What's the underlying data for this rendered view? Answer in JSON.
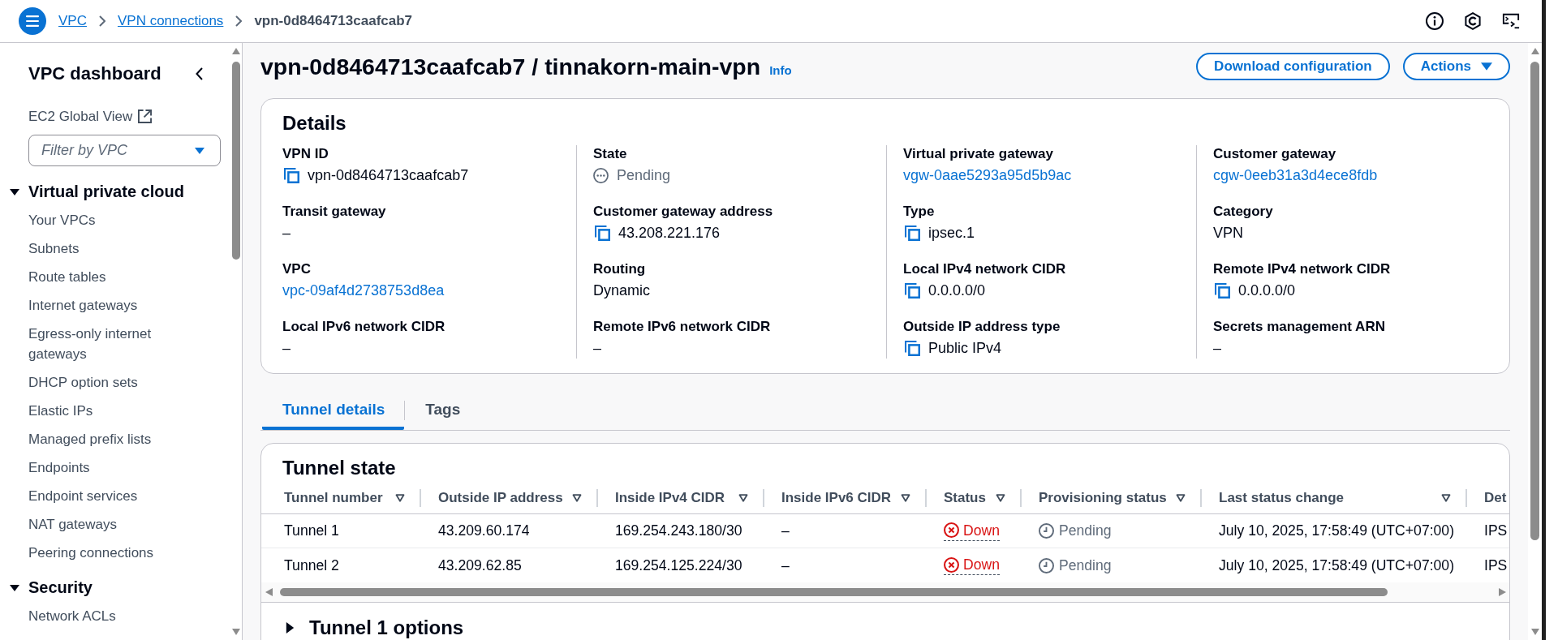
{
  "top_bar": {
    "breadcrumbs": [
      {
        "label": "VPC",
        "kind": "link"
      },
      {
        "label": "VPN connections",
        "kind": "link"
      },
      {
        "label": "vpn-0d8464713caafcab7",
        "kind": "current"
      }
    ]
  },
  "sidebar": {
    "title": "VPC dashboard",
    "global_view": "EC2 Global View",
    "filter": {
      "placeholder": "Filter by VPC"
    },
    "sections": [
      {
        "title": "Virtual private cloud",
        "expanded": true,
        "items": [
          "Your VPCs",
          "Subnets",
          "Route tables",
          "Internet gateways",
          "Egress-only internet gateways",
          "DHCP option sets",
          "Elastic IPs",
          "Managed prefix lists",
          "Endpoints",
          "Endpoint services",
          "NAT gateways",
          "Peering connections"
        ]
      },
      {
        "title": "Security",
        "expanded": true,
        "items": [
          "Network ACLs"
        ]
      }
    ]
  },
  "page_header": {
    "title": "vpn-0d8464713caafcab7 / tinnakorn-main-vpn",
    "info": "Info",
    "buttons": [
      {
        "label": "Download configuration",
        "kind": "normal"
      },
      {
        "label": "Actions",
        "kind": "dropdown"
      }
    ]
  },
  "details": {
    "title": "Details",
    "columns": [
      {
        "fields": [
          {
            "label": "VPN ID",
            "value": "vpn-0d8464713caafcab7",
            "kind": "copy"
          },
          {
            "label": "Transit gateway",
            "value": "–",
            "kind": "text"
          },
          {
            "label": "VPC",
            "value": "vpc-09af4d2738753d8ea",
            "kind": "link"
          },
          {
            "label": "Local IPv6 network CIDR",
            "value": "–",
            "kind": "text"
          }
        ]
      },
      {
        "fields": [
          {
            "label": "State",
            "value": "Pending",
            "kind": "status"
          },
          {
            "label": "Customer gateway address",
            "value": "43.208.221.176",
            "kind": "copy"
          },
          {
            "label": "Routing",
            "value": "Dynamic",
            "kind": "text"
          },
          {
            "label": "Remote IPv6 network CIDR",
            "value": "–",
            "kind": "text"
          }
        ]
      },
      {
        "fields": [
          {
            "label": "Virtual private gateway",
            "value": "vgw-0aae5293a95d5b9ac",
            "kind": "link"
          },
          {
            "label": "Type",
            "value": "ipsec.1",
            "kind": "copy"
          },
          {
            "label": "Local IPv4 network CIDR",
            "value": "0.0.0.0/0",
            "kind": "copy"
          },
          {
            "label": "Outside IP address type",
            "value": "Public IPv4",
            "kind": "copy"
          }
        ]
      },
      {
        "fields": [
          {
            "label": "Customer gateway",
            "value": "cgw-0eeb31a3d4ece8fdb",
            "kind": "link"
          },
          {
            "label": "Category",
            "value": "VPN",
            "kind": "text"
          },
          {
            "label": "Remote IPv4 network CIDR",
            "value": "0.0.0.0/0",
            "kind": "copy"
          },
          {
            "label": "Secrets management ARN",
            "value": "–",
            "kind": "text"
          }
        ]
      }
    ]
  },
  "tabs": [
    {
      "label": "Tunnel details",
      "selected": true
    },
    {
      "label": "Tags",
      "selected": false
    }
  ],
  "tunnel_state": {
    "title": "Tunnel state",
    "columns": [
      {
        "label": "Tunnel number",
        "sortable": true
      },
      {
        "label": "Outside IP address",
        "sortable": true
      },
      {
        "label": "Inside IPv4 CIDR",
        "sortable": true
      },
      {
        "label": "Inside IPv6 CIDR",
        "sortable": true
      },
      {
        "label": "Status",
        "sortable": true
      },
      {
        "label": "Provisioning status",
        "sortable": true
      },
      {
        "label": "Last status change",
        "sortable": true
      },
      {
        "label": "Det",
        "sortable": false
      }
    ],
    "rows": [
      [
        {
          "text": "Tunnel 1",
          "kind": "text"
        },
        {
          "text": "43.209.60.174",
          "kind": "text"
        },
        {
          "text": "169.254.243.180/30",
          "kind": "text"
        },
        {
          "text": "–",
          "kind": "text"
        },
        {
          "text": "Down",
          "kind": "error"
        },
        {
          "text": "Pending",
          "kind": "pending"
        },
        {
          "text": "July 10, 2025, 17:58:49 (UTC+07:00)",
          "kind": "text"
        },
        {
          "text": "IPS",
          "kind": "text"
        }
      ],
      [
        {
          "text": "Tunnel 2",
          "kind": "text"
        },
        {
          "text": "43.209.62.85",
          "kind": "text"
        },
        {
          "text": "169.254.125.224/30",
          "kind": "text"
        },
        {
          "text": "–",
          "kind": "text"
        },
        {
          "text": "Down",
          "kind": "error"
        },
        {
          "text": "Pending",
          "kind": "pending"
        },
        {
          "text": "July 10, 2025, 17:58:49 (UTC+07:00)",
          "kind": "text"
        },
        {
          "text": "IPS",
          "kind": "text"
        }
      ]
    ],
    "options": {
      "title": "Tunnel 1 options",
      "expanded": false
    }
  }
}
